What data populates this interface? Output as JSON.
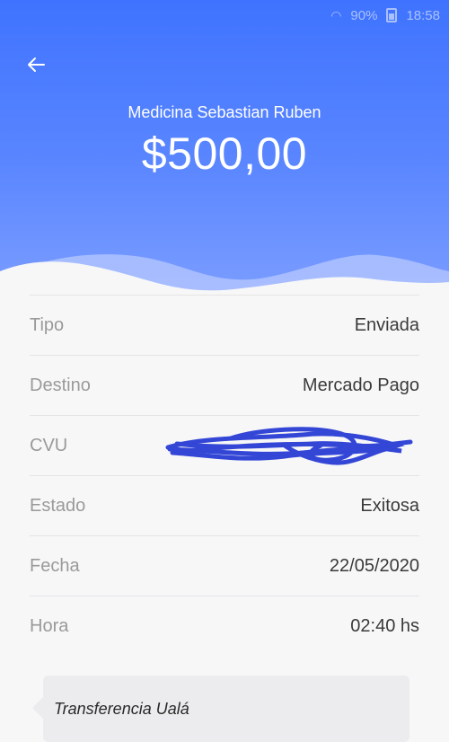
{
  "status_bar": {
    "battery": "90%",
    "time": "18:58"
  },
  "header": {
    "merchant": "Medicina Sebastian Ruben",
    "amount": "$500,00",
    "gradient_top": "#3f73ff",
    "gradient_bottom": "#7b9dff"
  },
  "details": {
    "rows": [
      {
        "label": "Tipo",
        "value": "Enviada"
      },
      {
        "label": "Destino",
        "value": "Mercado Pago"
      },
      {
        "label": "CVU",
        "value": ""
      },
      {
        "label": "Estado",
        "value": "Exitosa"
      },
      {
        "label": "Fecha",
        "value": "22/05/2020"
      },
      {
        "label": "Hora",
        "value": "02:40 hs"
      }
    ]
  },
  "note": {
    "text": "Transferencia Ualá"
  },
  "icons": {
    "back": "arrow-left-icon",
    "redaction": "scribble-redaction-icon"
  }
}
